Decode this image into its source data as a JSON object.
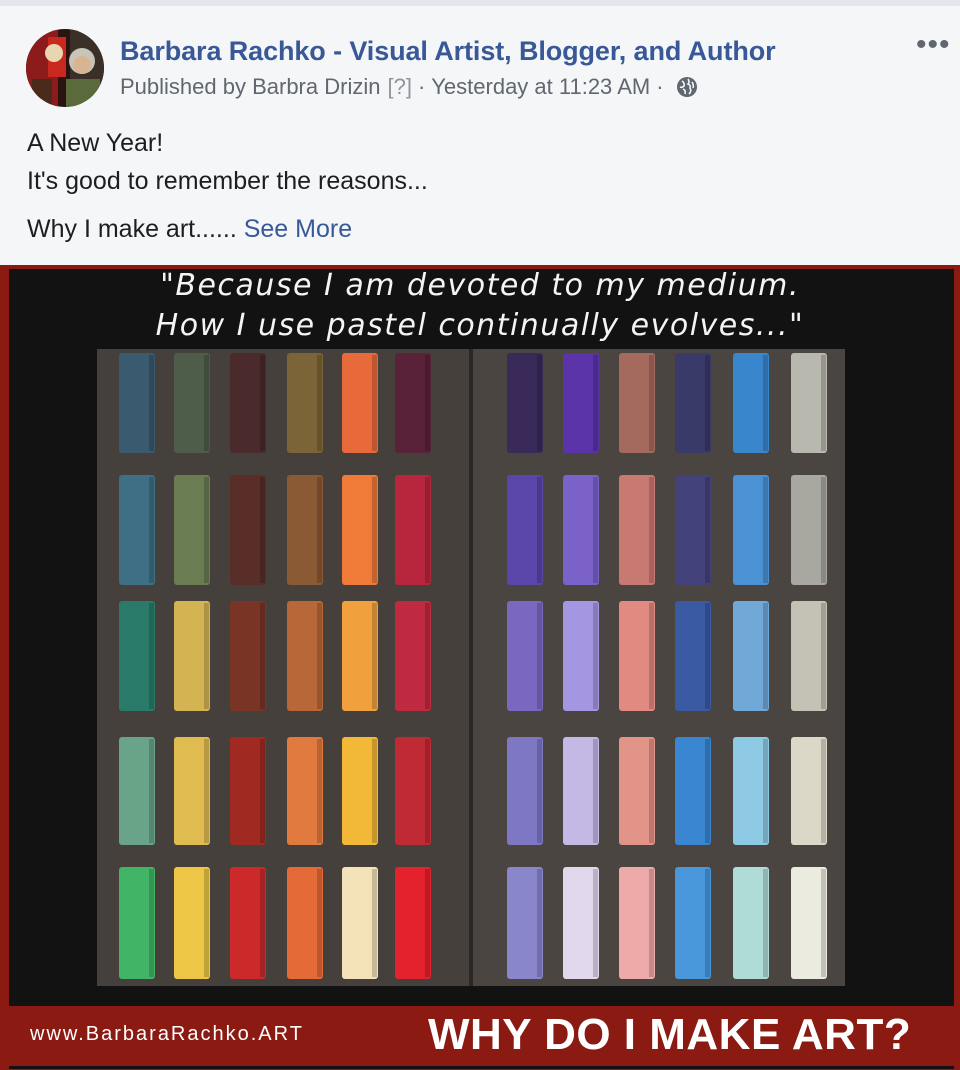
{
  "post": {
    "page_name": "Barbara Rachko - Visual Artist, Blogger, and Author",
    "published_by": "Published by Barbra Drizin",
    "help_marker": "[?]",
    "separator": "·",
    "timestamp": "Yesterday at 11:23 AM",
    "audience_icon": "globe-icon",
    "more_icon": "more-options-icon",
    "more_label": "•••",
    "text_line_1": "A New Year!",
    "text_line_2": "It's good to remember the reasons...",
    "text_line_3": "Why I make art......",
    "see_more": "See More"
  },
  "image": {
    "quote_line_1": "\"Because I am devoted to my medium.",
    "quote_line_2": "How I use pastel continually evolves...\"",
    "website": "www.BarbaraRachko.ART",
    "headline": "WHY DO I MAKE ART?",
    "pastel_colors": [
      [
        "#3a5a70",
        "#4e5d4a",
        "#4a2a2a",
        "#7a6438",
        "#e86a3a",
        "#5a2238",
        "#3a2a5a",
        "#5a34a8",
        "#a56a5e",
        "#3a3a68",
        "#3a86cc",
        "#b8b8ae"
      ],
      [
        "#3e6f84",
        "#6a7c52",
        "#5a2e28",
        "#8a5a34",
        "#f07a38",
        "#b8263e",
        "#5a46a8",
        "#7a62c8",
        "#c87a72",
        "#44427a",
        "#4a92d4",
        "#a8a8a0"
      ],
      [
        "#2a7a6a",
        "#d4b452",
        "#7a3426",
        "#b86838",
        "#f0a03c",
        "#c02a40",
        "#7a68c0",
        "#a496e0",
        "#e08a82",
        "#3a5aa4",
        "#70a8d8",
        "#c4c2b4"
      ],
      [
        "#6aa488",
        "#e0bc50",
        "#a02a22",
        "#e07a3e",
        "#f2b838",
        "#c02a34",
        "#7e78c4",
        "#c4b8e4",
        "#e29488",
        "#3a86d0",
        "#8ecae4",
        "#dcd8c8"
      ],
      [
        "#42b466",
        "#ecc644",
        "#cc2a2a",
        "#e46a38",
        "#f4e2b8",
        "#e4222e",
        "#8a86cc",
        "#e2d8ee",
        "#eeaaa8",
        "#4a98dc",
        "#b0dcd8",
        "#ecebe0"
      ]
    ]
  }
}
